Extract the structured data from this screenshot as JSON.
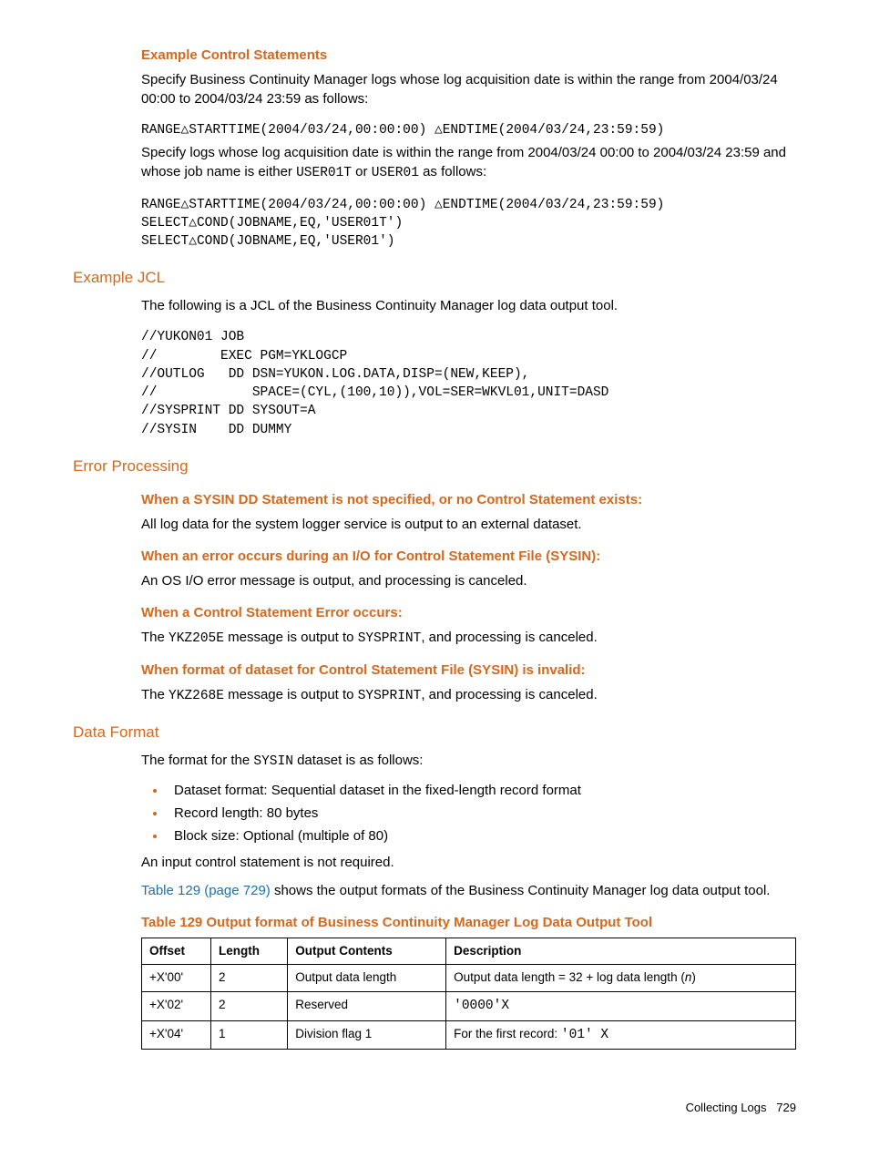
{
  "section1": {
    "title": "Example Control Statements",
    "para1": "Specify Business Continuity Manager logs whose log acquisition date is within the range from 2004/03/24 00:00 to 2004/03/24 23:59 as follows:",
    "code1": "RANGE△STARTTIME(2004/03/24,00:00:00) △ENDTIME(2004/03/24,23:59:59)",
    "para2_a": "Specify logs whose log acquisition date is within the range from 2004/03/24 00:00 to 2004/03/24 23:59 and whose job name is either ",
    "para2_code1": "USER01T",
    "para2_mid": " or ",
    "para2_code2": "USER01",
    "para2_end": " as follows:",
    "code2": "RANGE△STARTTIME(2004/03/24,00:00:00) △ENDTIME(2004/03/24,23:59:59)\nSELECT△COND(JOBNAME,EQ,'USER01T')\nSELECT△COND(JOBNAME,EQ,'USER01')"
  },
  "section2": {
    "heading": "Example JCL",
    "para": "The following is a JCL of the Business Continuity Manager log data output tool.",
    "code": "//YUKON01 JOB\n//        EXEC PGM=YKLOGCP\n//OUTLOG   DD DSN=YUKON.LOG.DATA,DISP=(NEW,KEEP),\n//            SPACE=(CYL,(100,10)),VOL=SER=WKVL01,UNIT=DASD\n//SYSPRINT DD SYSOUT=A\n//SYSIN    DD DUMMY"
  },
  "section3": {
    "heading": "Error Processing",
    "items": [
      {
        "title": "When a SYSIN DD Statement is not specified, or no Control Statement exists:",
        "body_plain": "All log data for the system logger service is output to an external dataset."
      },
      {
        "title": "When an error occurs during an I/O for Control Statement File (SYSIN):",
        "body_plain": "An OS I/O error message is output, and processing is canceled."
      },
      {
        "title": "When a Control Statement Error occurs:",
        "body_pre": "The ",
        "code1": "YKZ205E",
        "body_mid": " message is output to ",
        "code2": "SYSPRINT",
        "body_end": ", and processing is canceled."
      },
      {
        "title": "When format of dataset for Control Statement File (SYSIN) is invalid:",
        "body_pre": "The ",
        "code1": "YKZ268E",
        "body_mid": " message is output to ",
        "code2": "SYSPRINT",
        "body_end": ", and processing is canceled."
      }
    ]
  },
  "section4": {
    "heading": "Data Format",
    "para1_pre": "The format for the ",
    "para1_code": "SYSIN",
    "para1_end": " dataset is as follows:",
    "bullets": [
      "Dataset format: Sequential dataset in the fixed-length record format",
      "Record length: 80 bytes",
      "Block size: Optional (multiple of 80)"
    ],
    "para2": "An input control statement is not required.",
    "para3_link": "Table 129 (page 729)",
    "para3_rest": " shows the output formats of the Business Continuity Manager log data output tool.",
    "table_title": "Table 129 Output format of Business Continuity Manager Log Data Output Tool",
    "headers": [
      "Offset",
      "Length",
      "Output Contents",
      "Description"
    ],
    "rows": [
      {
        "offset": "+X'00'",
        "length": "2",
        "contents": "Output data length",
        "desc_pre": "Output data length = 32 + log data length (",
        "desc_i": "n",
        "desc_post": ")"
      },
      {
        "offset": "+X'02'",
        "length": "2",
        "contents": "Reserved",
        "desc_code": "'0000'X"
      },
      {
        "offset": "+X'04'",
        "length": "1",
        "contents": "Division flag 1",
        "desc_pre2": "For the first record: ",
        "desc_code2": "'01' X"
      }
    ]
  },
  "footer": {
    "text": "Collecting Logs",
    "page": "729"
  }
}
